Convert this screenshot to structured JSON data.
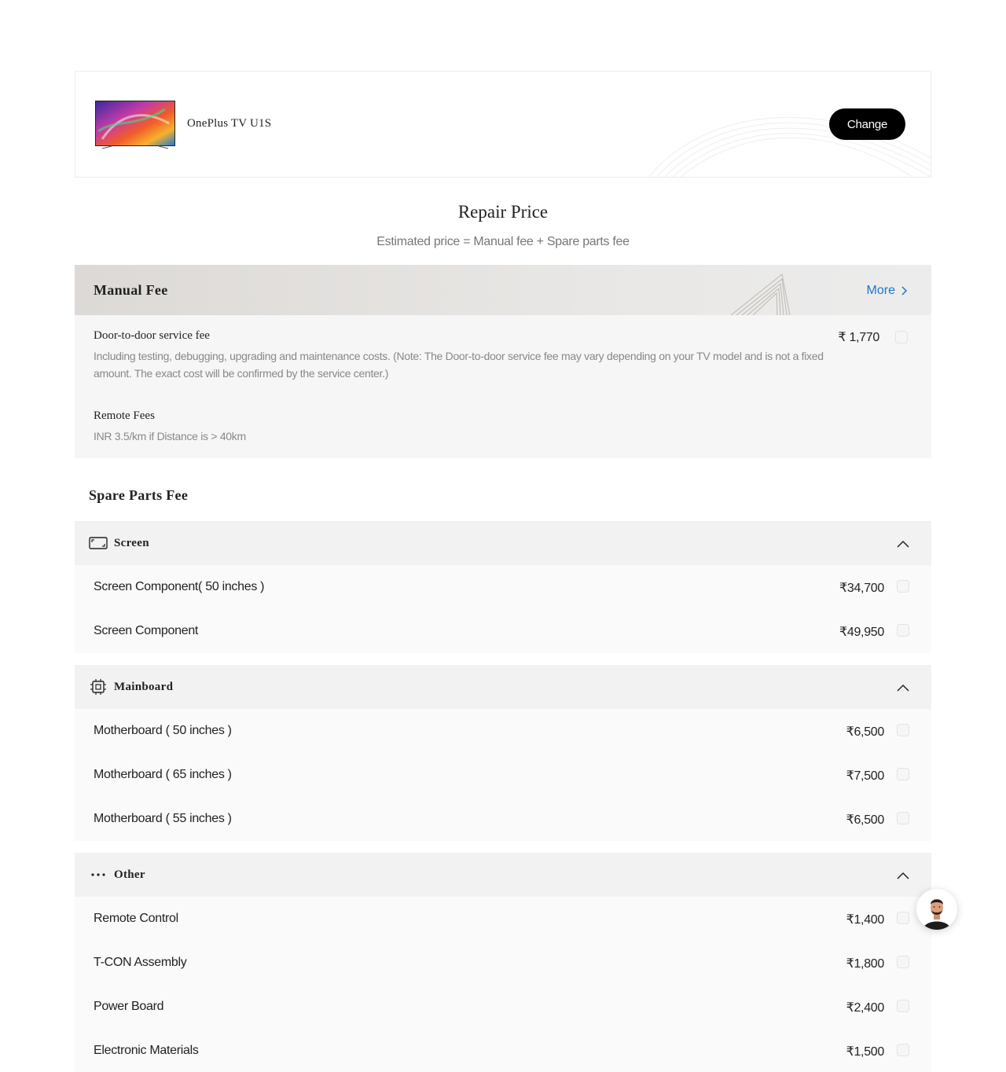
{
  "product": {
    "name": "OnePlus TV U1S",
    "change_label": "Change"
  },
  "header": {
    "title": "Repair Price",
    "subtitle": "Estimated price = Manual fee + Spare parts fee"
  },
  "manual_fee": {
    "title": "Manual Fee",
    "more_label": "More",
    "items": [
      {
        "name": "Door-to-door service fee",
        "description": "Including testing, debugging, upgrading and maintenance costs. (Note: The Door-to-door service fee may vary depending on your TV model and is not a fixed amount. The exact cost will be confirmed by the service center.)",
        "price": "₹ 1,770"
      },
      {
        "name": "Remote Fees",
        "description": "INR 3.5/km if Distance is > 40km"
      }
    ]
  },
  "spare_parts": {
    "title": "Spare Parts Fee",
    "categories": [
      {
        "name": "Screen",
        "icon": "screen-icon",
        "items": [
          {
            "name": "Screen Component( 50 inches )",
            "price": "₹34,700"
          },
          {
            "name": "Screen Component",
            "price": "₹49,950"
          }
        ]
      },
      {
        "name": "Mainboard",
        "icon": "chip-icon",
        "items": [
          {
            "name": "Motherboard ( 50 inches )",
            "price": "₹6,500"
          },
          {
            "name": "Motherboard ( 65 inches )",
            "price": "₹7,500"
          },
          {
            "name": "Motherboard ( 55 inches )",
            "price": "₹6,500"
          }
        ]
      },
      {
        "name": "Other",
        "icon": "more-dots-icon",
        "items": [
          {
            "name": "Remote Control",
            "price": "₹1,400"
          },
          {
            "name": "T-CON Assembly",
            "price": "₹1,800"
          },
          {
            "name": "Power Board",
            "price": "₹2,400"
          },
          {
            "name": "Electronic Materials",
            "price": "₹1,500"
          }
        ]
      }
    ]
  },
  "colors": {
    "accent_link": "#1976d2",
    "button_bg": "#000000"
  }
}
